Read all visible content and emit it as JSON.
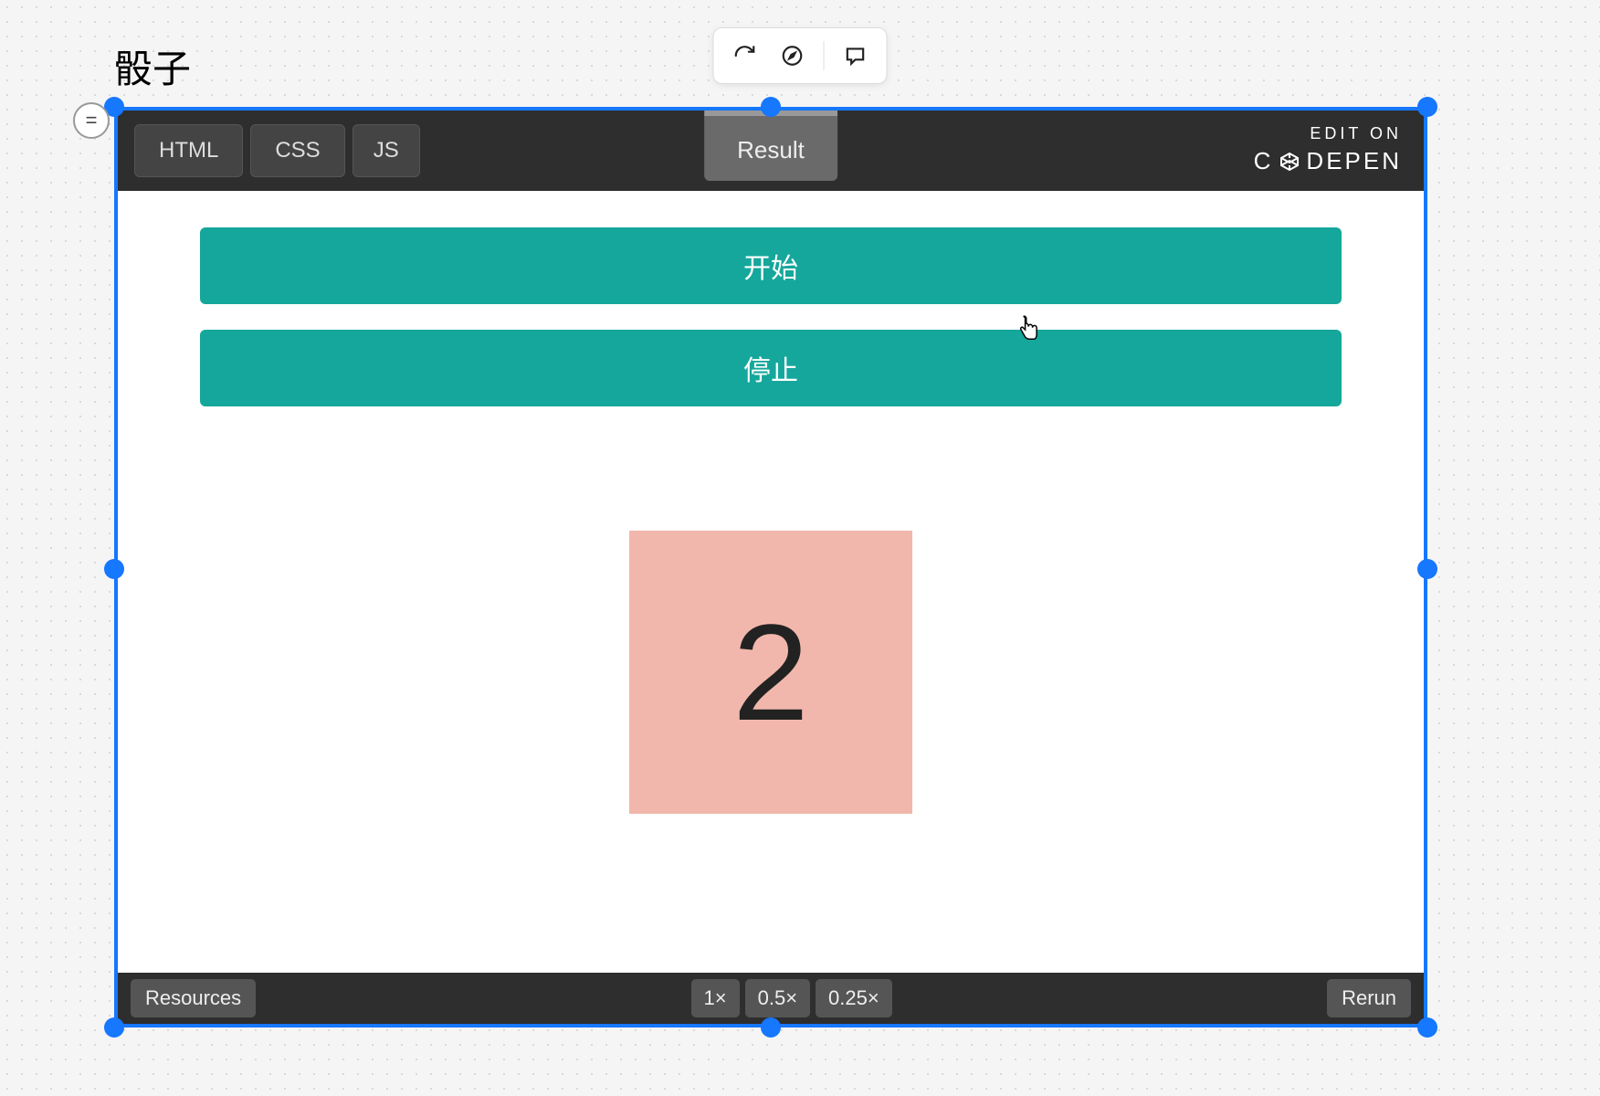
{
  "page": {
    "title": "骰子"
  },
  "toolbar": {
    "refresh_icon": "refresh",
    "compass_icon": "compass",
    "comment_icon": "comment"
  },
  "handle_badge": "=",
  "codepen": {
    "tabs": {
      "html": "HTML",
      "css": "CSS",
      "js": "JS"
    },
    "result_tab": "Result",
    "edit_on": "EDIT ON",
    "brand": "C   DEPEN"
  },
  "result": {
    "start_button": "开始",
    "stop_button": "停止",
    "dice_value": "2"
  },
  "footer": {
    "resources": "Resources",
    "zoom": [
      "1×",
      "0.5×",
      "0.25×"
    ],
    "rerun": "Rerun"
  },
  "colors": {
    "selection": "#1677ff",
    "teal": "#15a79b",
    "dice_bg": "#f2b7ac",
    "header_bg": "#2e2e2e"
  }
}
